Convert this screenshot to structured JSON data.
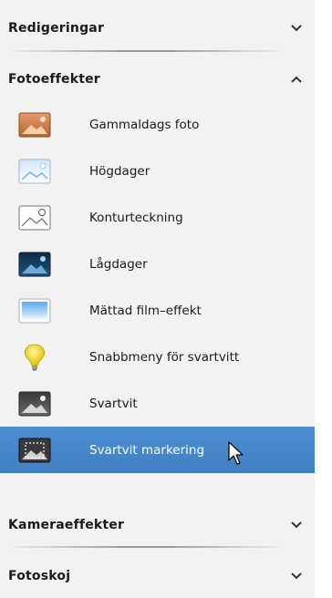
{
  "sections": [
    {
      "title": "Redigeringar",
      "expanded": false
    },
    {
      "title": "Fotoeffekter",
      "expanded": true
    },
    {
      "title": "Kameraeffekter",
      "expanded": false
    },
    {
      "title": "Fotoskoj",
      "expanded": false
    }
  ],
  "fotoeffekter_items": [
    {
      "label": "Gammaldags foto",
      "icon": "sepia-photo-icon"
    },
    {
      "label": "Högdager",
      "icon": "highlights-photo-icon"
    },
    {
      "label": "Konturteckning",
      "icon": "sketch-photo-icon"
    },
    {
      "label": "Lågdager",
      "icon": "shadows-photo-icon"
    },
    {
      "label": "Mättad film–effekt",
      "icon": "saturated-film-icon"
    },
    {
      "label": "Snabbmeny för svartvitt",
      "icon": "lightbulb-icon"
    },
    {
      "label": "Svartvit",
      "icon": "black-white-photo-icon"
    },
    {
      "label": "Svartvit markering",
      "icon": "black-white-selection-icon",
      "selected": true
    }
  ],
  "colors": {
    "selected_background": "#4682c8",
    "panel_background": "#f2f2f2"
  }
}
